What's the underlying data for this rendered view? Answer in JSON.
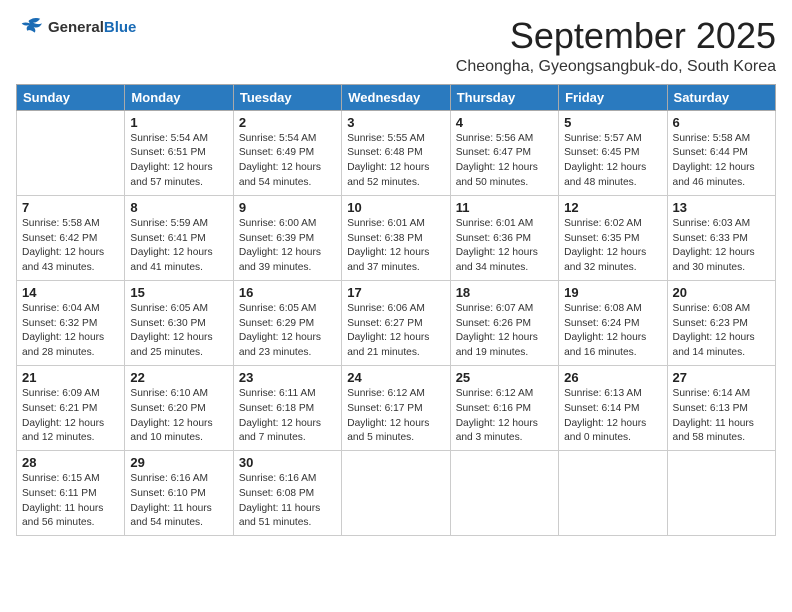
{
  "logo": {
    "general": "General",
    "blue": "Blue"
  },
  "title": "September 2025",
  "location": "Cheongha, Gyeongsangbuk-do, South Korea",
  "days_of_week": [
    "Sunday",
    "Monday",
    "Tuesday",
    "Wednesday",
    "Thursday",
    "Friday",
    "Saturday"
  ],
  "weeks": [
    [
      {
        "day": "",
        "info": ""
      },
      {
        "day": "1",
        "info": "Sunrise: 5:54 AM\nSunset: 6:51 PM\nDaylight: 12 hours\nand 57 minutes."
      },
      {
        "day": "2",
        "info": "Sunrise: 5:54 AM\nSunset: 6:49 PM\nDaylight: 12 hours\nand 54 minutes."
      },
      {
        "day": "3",
        "info": "Sunrise: 5:55 AM\nSunset: 6:48 PM\nDaylight: 12 hours\nand 52 minutes."
      },
      {
        "day": "4",
        "info": "Sunrise: 5:56 AM\nSunset: 6:47 PM\nDaylight: 12 hours\nand 50 minutes."
      },
      {
        "day": "5",
        "info": "Sunrise: 5:57 AM\nSunset: 6:45 PM\nDaylight: 12 hours\nand 48 minutes."
      },
      {
        "day": "6",
        "info": "Sunrise: 5:58 AM\nSunset: 6:44 PM\nDaylight: 12 hours\nand 46 minutes."
      }
    ],
    [
      {
        "day": "7",
        "info": "Sunrise: 5:58 AM\nSunset: 6:42 PM\nDaylight: 12 hours\nand 43 minutes."
      },
      {
        "day": "8",
        "info": "Sunrise: 5:59 AM\nSunset: 6:41 PM\nDaylight: 12 hours\nand 41 minutes."
      },
      {
        "day": "9",
        "info": "Sunrise: 6:00 AM\nSunset: 6:39 PM\nDaylight: 12 hours\nand 39 minutes."
      },
      {
        "day": "10",
        "info": "Sunrise: 6:01 AM\nSunset: 6:38 PM\nDaylight: 12 hours\nand 37 minutes."
      },
      {
        "day": "11",
        "info": "Sunrise: 6:01 AM\nSunset: 6:36 PM\nDaylight: 12 hours\nand 34 minutes."
      },
      {
        "day": "12",
        "info": "Sunrise: 6:02 AM\nSunset: 6:35 PM\nDaylight: 12 hours\nand 32 minutes."
      },
      {
        "day": "13",
        "info": "Sunrise: 6:03 AM\nSunset: 6:33 PM\nDaylight: 12 hours\nand 30 minutes."
      }
    ],
    [
      {
        "day": "14",
        "info": "Sunrise: 6:04 AM\nSunset: 6:32 PM\nDaylight: 12 hours\nand 28 minutes."
      },
      {
        "day": "15",
        "info": "Sunrise: 6:05 AM\nSunset: 6:30 PM\nDaylight: 12 hours\nand 25 minutes."
      },
      {
        "day": "16",
        "info": "Sunrise: 6:05 AM\nSunset: 6:29 PM\nDaylight: 12 hours\nand 23 minutes."
      },
      {
        "day": "17",
        "info": "Sunrise: 6:06 AM\nSunset: 6:27 PM\nDaylight: 12 hours\nand 21 minutes."
      },
      {
        "day": "18",
        "info": "Sunrise: 6:07 AM\nSunset: 6:26 PM\nDaylight: 12 hours\nand 19 minutes."
      },
      {
        "day": "19",
        "info": "Sunrise: 6:08 AM\nSunset: 6:24 PM\nDaylight: 12 hours\nand 16 minutes."
      },
      {
        "day": "20",
        "info": "Sunrise: 6:08 AM\nSunset: 6:23 PM\nDaylight: 12 hours\nand 14 minutes."
      }
    ],
    [
      {
        "day": "21",
        "info": "Sunrise: 6:09 AM\nSunset: 6:21 PM\nDaylight: 12 hours\nand 12 minutes."
      },
      {
        "day": "22",
        "info": "Sunrise: 6:10 AM\nSunset: 6:20 PM\nDaylight: 12 hours\nand 10 minutes."
      },
      {
        "day": "23",
        "info": "Sunrise: 6:11 AM\nSunset: 6:18 PM\nDaylight: 12 hours\nand 7 minutes."
      },
      {
        "day": "24",
        "info": "Sunrise: 6:12 AM\nSunset: 6:17 PM\nDaylight: 12 hours\nand 5 minutes."
      },
      {
        "day": "25",
        "info": "Sunrise: 6:12 AM\nSunset: 6:16 PM\nDaylight: 12 hours\nand 3 minutes."
      },
      {
        "day": "26",
        "info": "Sunrise: 6:13 AM\nSunset: 6:14 PM\nDaylight: 12 hours\nand 0 minutes."
      },
      {
        "day": "27",
        "info": "Sunrise: 6:14 AM\nSunset: 6:13 PM\nDaylight: 11 hours\nand 58 minutes."
      }
    ],
    [
      {
        "day": "28",
        "info": "Sunrise: 6:15 AM\nSunset: 6:11 PM\nDaylight: 11 hours\nand 56 minutes."
      },
      {
        "day": "29",
        "info": "Sunrise: 6:16 AM\nSunset: 6:10 PM\nDaylight: 11 hours\nand 54 minutes."
      },
      {
        "day": "30",
        "info": "Sunrise: 6:16 AM\nSunset: 6:08 PM\nDaylight: 11 hours\nand 51 minutes."
      },
      {
        "day": "",
        "info": ""
      },
      {
        "day": "",
        "info": ""
      },
      {
        "day": "",
        "info": ""
      },
      {
        "day": "",
        "info": ""
      }
    ]
  ]
}
